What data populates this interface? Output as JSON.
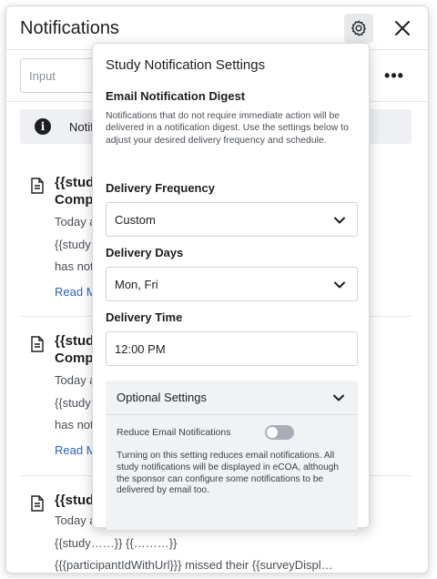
{
  "header": {
    "title": "Notifications"
  },
  "search": {
    "placeholder": "Input"
  },
  "info_banner": {
    "text": "Notif"
  },
  "notifications": [
    {
      "title_line1": "{{stud",
      "title_line2": "Compl",
      "meta_line1": "Today a",
      "meta_line2": "{{study",
      "meta_line3": "has not",
      "read_more": "Read M"
    },
    {
      "title_line1": "{{stud",
      "title_line2": "Compl",
      "meta_line1": "Today a",
      "meta_line2": "{{study",
      "meta_line3": "has not",
      "read_more": "Read M"
    },
    {
      "title_line1": "{{stud",
      "meta_line1": "Today a",
      "meta_line2": "{{study……}} {{………}}",
      "meta_line3": "{{{participantIdWithUrl}}} missed their {{surveyDispl…"
    }
  ],
  "settings_popover": {
    "title": "Study Notification Settings",
    "digest_heading": "Email Notification Digest",
    "digest_description": "Notifications that do not require immediate action will be delivered in a notification digest. Use the settings below to adjust your desired delivery frequency and schedule.",
    "delivery_frequency": {
      "label": "Delivery Frequency",
      "value": "Custom"
    },
    "delivery_days": {
      "label": "Delivery Days",
      "value": "Mon, Fri"
    },
    "delivery_time": {
      "label": "Delivery Time",
      "value": "12:00 PM"
    },
    "optional_settings": {
      "title": "Optional Settings",
      "reduce_email": {
        "label": "Reduce Email Notifications",
        "enabled": false
      },
      "reduce_email_description": "Turning on this setting reduces email notifications. All study notifications will be displayed in eCOA, although the sponsor can configure some notifications to be delivered by email too."
    }
  },
  "colors": {
    "link": "#2a63c4",
    "toggle_off": "#a9aeb5",
    "active_icon_bg": "#e7e9ec"
  }
}
